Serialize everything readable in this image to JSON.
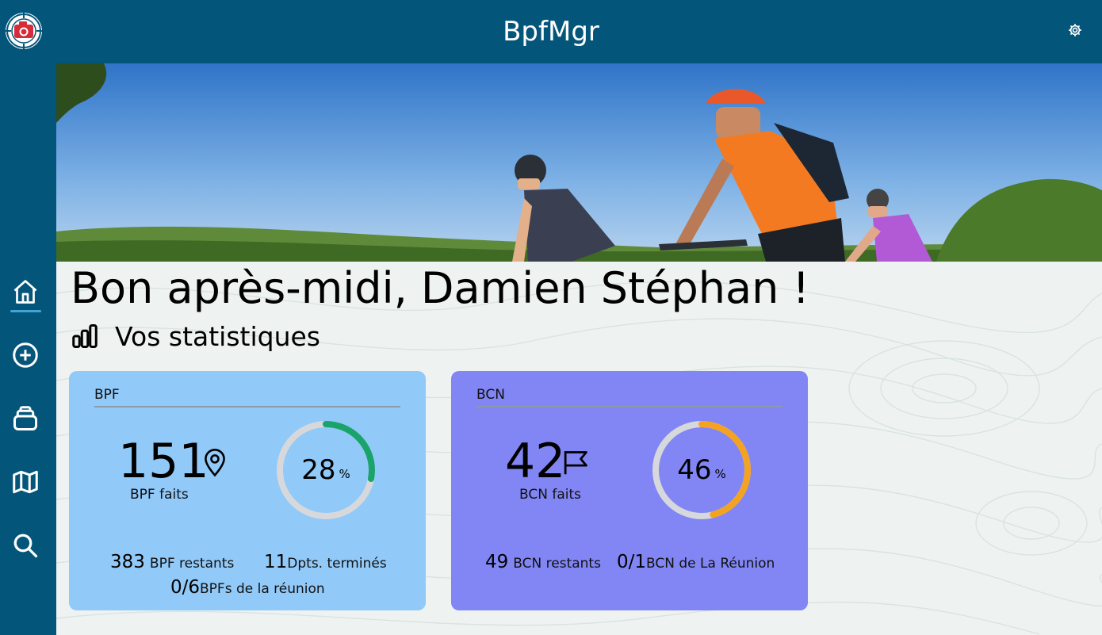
{
  "app": {
    "title": "BpfMgr"
  },
  "icons": {
    "logo": "camera-compass-logo",
    "settings": "gear-icon",
    "nav": [
      "home-icon",
      "add-circle-icon",
      "layers-icon",
      "map-icon",
      "search-icon"
    ],
    "stats": "bar-chart-icon",
    "bpf": "map-pin-icon",
    "bcn": "flag-icon"
  },
  "colors": {
    "header": "#04557a",
    "active_nav": "#3fa5d8",
    "bpf_card": "#91c9f8",
    "bcn_card": "#8186f4",
    "bpf_progress": "#1aa36b",
    "bcn_progress": "#f3a321",
    "ring_track": "#d6d8dc"
  },
  "greeting": "Bon après-midi, Damien Stéphan !",
  "stats": {
    "title": "Vos statistiques"
  },
  "bpf": {
    "label": "BPF",
    "count": "151",
    "count_label": "BPF faits",
    "percent": 28,
    "percent_text": "28",
    "percent_sign": "%",
    "remaining_value": "383",
    "remaining_label": "BPF restants",
    "depts_value": "11",
    "depts_label": "Dpts. terminés",
    "reunion_value": "0/6",
    "reunion_label": "BPFs de la réunion"
  },
  "bcn": {
    "label": "BCN",
    "count": "42",
    "count_label": "BCN faits",
    "percent": 46,
    "percent_text": "46",
    "percent_sign": "%",
    "remaining_value": "49",
    "remaining_label": "BCN restants",
    "reunion_value": "0/1",
    "reunion_label": "BCN de La Réunion"
  }
}
